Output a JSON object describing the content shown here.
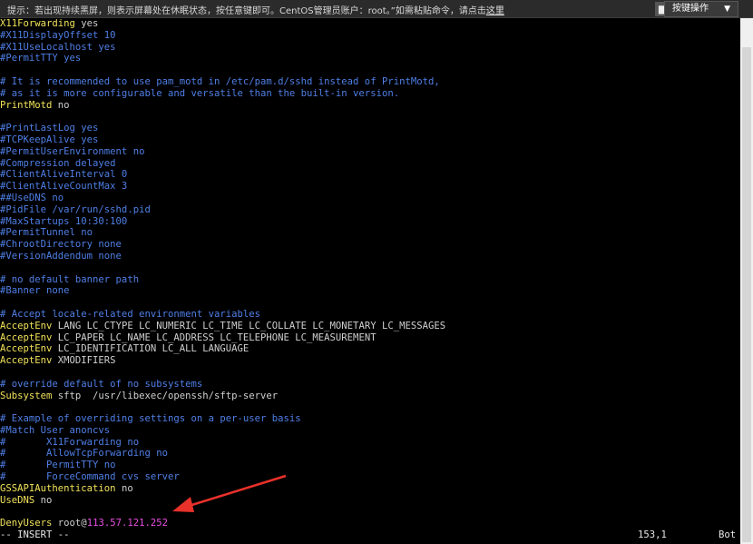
{
  "topbar": {
    "notice_text": "提示：若出现持续黑屏，则表示屏幕处在休眠状态，按任意键即可。CentOS管理员账户：root。”如需粘贴命令，请点击",
    "notice_link": "这里",
    "close_label": "■",
    "shortcut_label": "按键操作",
    "shortcut_caret": "▼"
  },
  "terminal": {
    "lines": [
      [
        {
          "t": "X11Forwarding",
          "c": "kw"
        },
        {
          "t": " yes",
          "c": "val"
        }
      ],
      [
        {
          "t": "#X11DisplayOffset 10",
          "c": "comment"
        }
      ],
      [
        {
          "t": "#X11UseLocalhost yes",
          "c": "comment"
        }
      ],
      [
        {
          "t": "#PermitTTY yes",
          "c": "comment"
        }
      ],
      [],
      [
        {
          "t": "# It is recommended to use pam_motd in /etc/pam.d/sshd instead of PrintMotd,",
          "c": "comment"
        }
      ],
      [
        {
          "t": "# as it is more configurable and versatile than the built-in version.",
          "c": "comment"
        }
      ],
      [
        {
          "t": "PrintMotd",
          "c": "kw"
        },
        {
          "t": " no",
          "c": "val"
        }
      ],
      [],
      [
        {
          "t": "#PrintLastLog yes",
          "c": "comment"
        }
      ],
      [
        {
          "t": "#TCPKeepAlive yes",
          "c": "comment"
        }
      ],
      [
        {
          "t": "#PermitUserEnvironment no",
          "c": "comment"
        }
      ],
      [
        {
          "t": "#Compression delayed",
          "c": "comment"
        }
      ],
      [
        {
          "t": "#ClientAliveInterval 0",
          "c": "comment"
        }
      ],
      [
        {
          "t": "#ClientAliveCountMax 3",
          "c": "comment"
        }
      ],
      [
        {
          "t": "##UseDNS no",
          "c": "comment"
        }
      ],
      [
        {
          "t": "#PidFile /var/run/sshd.pid",
          "c": "comment"
        }
      ],
      [
        {
          "t": "#MaxStartups 10:30:100",
          "c": "comment"
        }
      ],
      [
        {
          "t": "#PermitTunnel no",
          "c": "comment"
        }
      ],
      [
        {
          "t": "#ChrootDirectory none",
          "c": "comment"
        }
      ],
      [
        {
          "t": "#VersionAddendum none",
          "c": "comment"
        }
      ],
      [],
      [
        {
          "t": "# no default banner path",
          "c": "comment"
        }
      ],
      [
        {
          "t": "#Banner none",
          "c": "comment"
        }
      ],
      [],
      [
        {
          "t": "# Accept locale-related environment variables",
          "c": "comment"
        }
      ],
      [
        {
          "t": "AcceptEnv",
          "c": "kw"
        },
        {
          "t": " LANG LC_CTYPE LC_NUMERIC LC_TIME LC_COLLATE LC_MONETARY LC_MESSAGES",
          "c": "val"
        }
      ],
      [
        {
          "t": "AcceptEnv",
          "c": "kw"
        },
        {
          "t": " LC_PAPER LC_NAME LC_ADDRESS LC_TELEPHONE LC_MEASUREMENT",
          "c": "val"
        }
      ],
      [
        {
          "t": "AcceptEnv",
          "c": "kw"
        },
        {
          "t": " LC_IDENTIFICATION LC_ALL LANGUAGE",
          "c": "val"
        }
      ],
      [
        {
          "t": "AcceptEnv",
          "c": "kw"
        },
        {
          "t": " XMODIFIERS",
          "c": "val"
        }
      ],
      [],
      [
        {
          "t": "# override default of no subsystems",
          "c": "comment"
        }
      ],
      [
        {
          "t": "Subsystem",
          "c": "kw"
        },
        {
          "t": " sftp  /usr/libexec/openssh/sftp-server",
          "c": "val"
        }
      ],
      [],
      [
        {
          "t": "# Example of overriding settings on a per-user basis",
          "c": "comment"
        }
      ],
      [
        {
          "t": "#Match User anoncvs",
          "c": "comment"
        }
      ],
      [
        {
          "t": "#       X11Forwarding no",
          "c": "comment"
        }
      ],
      [
        {
          "t": "#       AllowTcpForwarding no",
          "c": "comment"
        }
      ],
      [
        {
          "t": "#       PermitTTY no",
          "c": "comment"
        }
      ],
      [
        {
          "t": "#       ForceCommand cvs server",
          "c": "comment"
        }
      ],
      [
        {
          "t": "GSSAPIAuthentication",
          "c": "kw"
        },
        {
          "t": " no",
          "c": "val"
        }
      ],
      [
        {
          "t": "UseDNS",
          "c": "kw"
        },
        {
          "t": " no",
          "c": "val"
        }
      ],
      [],
      [
        {
          "t": "DenyUsers",
          "c": "kw"
        },
        {
          "t": " root@",
          "c": "val"
        },
        {
          "t": "113.57.121.252",
          "c": "ip"
        }
      ]
    ],
    "mode": "-- INSERT --",
    "cursor_pos": "153,1",
    "scroll_pos": "Bot"
  },
  "colors": {
    "comment": "#4f7fe6",
    "keyword": "#f1e25a",
    "value": "#cfcfcf",
    "ip": "#e84ee0",
    "arrow": "#e8312a"
  }
}
